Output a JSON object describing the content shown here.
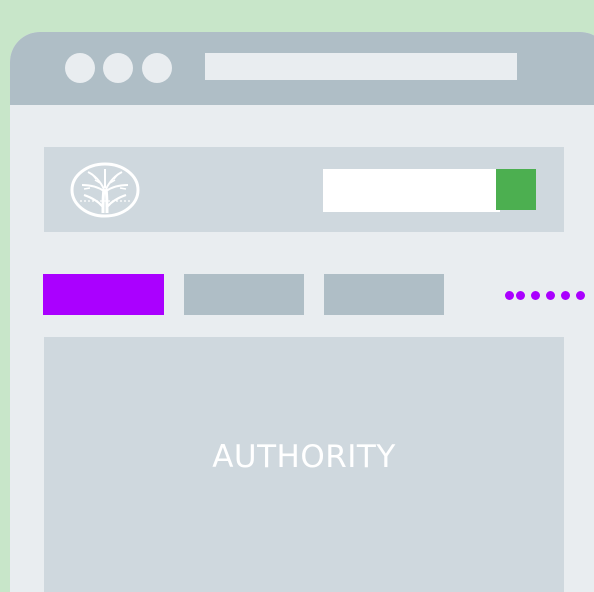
{
  "window": {
    "controls": [
      "close",
      "minimize",
      "maximize"
    ]
  },
  "address_bar": {
    "value": ""
  },
  "header": {
    "logo_icon": "tree-logo-icon",
    "search": {
      "value": "",
      "placeholder": ""
    },
    "search_button_icon": "none"
  },
  "tabs": [
    {
      "label": "",
      "active": true
    },
    {
      "label": "",
      "active": false
    },
    {
      "label": "",
      "active": false
    }
  ],
  "more_icon": "more-dots-icon",
  "content": {
    "title": "AUTHORITY"
  },
  "colors": {
    "background": "#c8e6c9",
    "titlebar": "#afbec6",
    "window": "#e9edf0",
    "panel": "#cfd8de",
    "accent": "#aa00ff",
    "search_button": "#4caf50"
  }
}
